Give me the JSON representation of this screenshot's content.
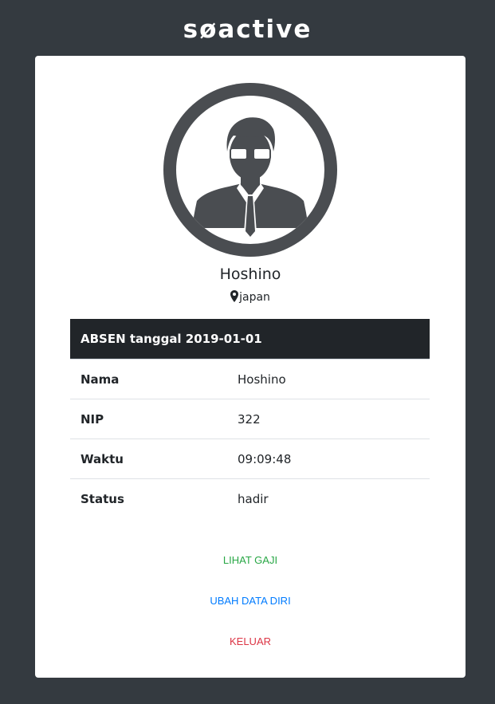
{
  "brand": {
    "logo_text": "søactive"
  },
  "profile": {
    "name": "Hoshino",
    "location": "japan",
    "avatar_icon": "user-avatar-icon",
    "location_icon": "map-pin-icon"
  },
  "attendance": {
    "header": "ABSEN tanggal 2019-01-01",
    "rows": [
      {
        "label": "Nama",
        "value": "Hoshino"
      },
      {
        "label": "NIP",
        "value": "322"
      },
      {
        "label": "Waktu",
        "value": "09:09:48"
      },
      {
        "label": "Status",
        "value": "hadir"
      }
    ]
  },
  "actions": {
    "view_salary": "LIHAT GAJI",
    "edit_profile": "UBAH DATA DIRI",
    "logout": "KELUAR"
  },
  "colors": {
    "background": "#343a40",
    "card": "#ffffff",
    "table_header": "#212529",
    "green": "#28a745",
    "blue": "#007bff",
    "red": "#dc3545"
  }
}
